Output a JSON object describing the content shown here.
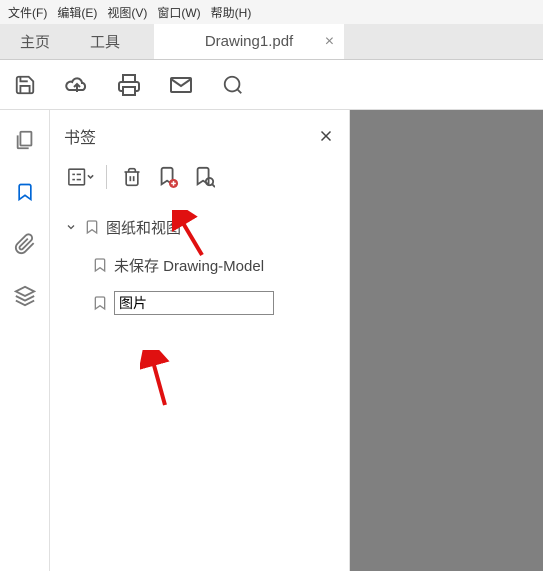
{
  "menu": {
    "file": "文件(F)",
    "edit": "编辑(E)",
    "view": "视图(V)",
    "window": "窗口(W)",
    "help": "帮助(H)"
  },
  "tabs": {
    "home": "主页",
    "tools": "工具",
    "doc": "Drawing1.pdf"
  },
  "panel": {
    "title": "书签"
  },
  "tree": {
    "root": "图纸和视图",
    "item1": "未保存 Drawing-Model",
    "item2_input": "图片"
  }
}
